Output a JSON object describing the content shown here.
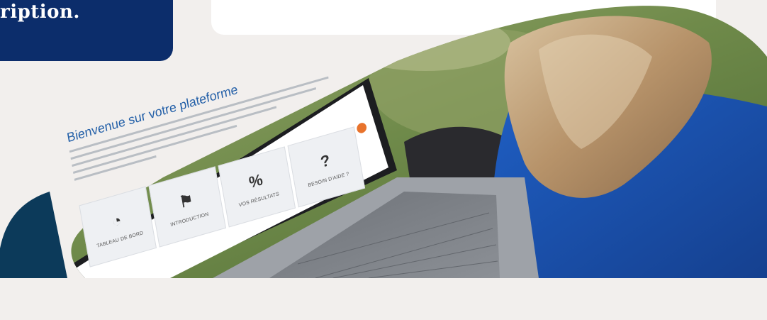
{
  "hero": {
    "headline": "ription."
  },
  "screen": {
    "title": "Bienvenue sur votre plateforme",
    "tiles": [
      {
        "icon": "dashboard-gauge-icon",
        "label": "TABLEAU DE BORD"
      },
      {
        "icon": "flag-icon",
        "label": "INTRODUCTION"
      },
      {
        "icon": "percent-icon",
        "label": "VOS RÉSULTATS"
      },
      {
        "icon": "question-circle-icon",
        "label": "BESOIN D'AIDE ?"
      }
    ]
  },
  "colors": {
    "navy": "#0c2d6b",
    "background": "#f2efed",
    "accent_orange": "#e8732c",
    "screen_title_blue": "#2460a8",
    "sweater_blue": "#1e54b4"
  }
}
